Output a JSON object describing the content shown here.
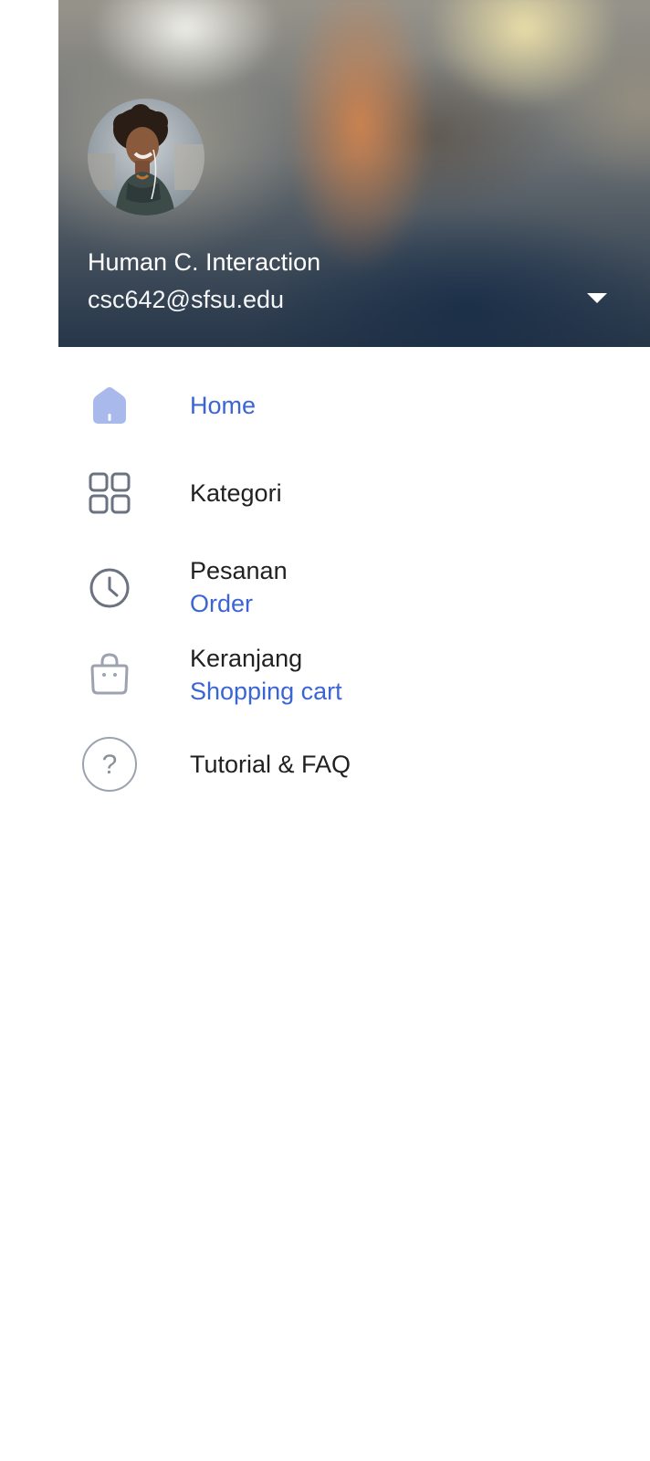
{
  "profile": {
    "name": "Human C. Interaction",
    "email": "csc642@sfsu.edu",
    "avatar_icon": "profile-photo",
    "toggle_icon": "caret-down-icon"
  },
  "menu": {
    "items": [
      {
        "label": "Home",
        "sublabel": "",
        "icon": "home-icon",
        "active": true
      },
      {
        "label": "Kategori",
        "sublabel": "",
        "icon": "grid-icon",
        "active": false
      },
      {
        "label": "Pesanan",
        "sublabel": "Order",
        "icon": "clock-icon",
        "active": false
      },
      {
        "label": "Keranjang",
        "sublabel": "Shopping cart",
        "icon": "bag-icon",
        "active": false
      },
      {
        "label": "Tutorial & FAQ",
        "sublabel": "",
        "icon": "help-icon",
        "active": false
      }
    ]
  },
  "colors": {
    "accent": "#3b65d4",
    "home_icon_fill": "#a9b9ec",
    "icon_gray": "#6b7280",
    "text_primary": "#212121"
  }
}
